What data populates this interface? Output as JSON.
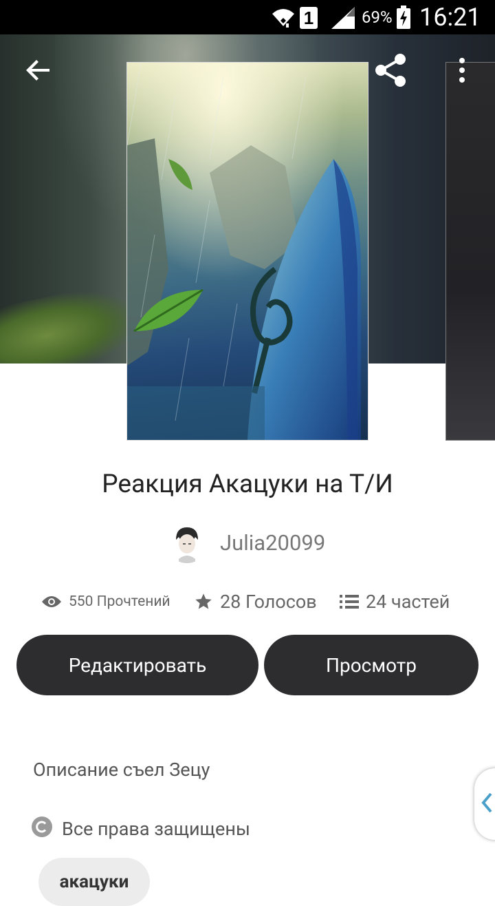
{
  "status_bar": {
    "sim_slot": "1",
    "battery_percent": "69%",
    "time": "16:21"
  },
  "story": {
    "title": "Реакция Акацуки на Т/И",
    "author": "Julia20099",
    "stats": {
      "reads": "550 Прочтений",
      "votes": "28 Голосов",
      "parts": "24 частей"
    },
    "description": "Описание съел Зецу",
    "rights": "Все права защищены",
    "tag": "акацуки"
  },
  "actions": {
    "edit_label": "Редактировать",
    "view_label": "Просмотр"
  },
  "colors": {
    "button_bg": "#2d2c2f",
    "button_text": "#ffffff",
    "title_text": "#222222",
    "muted_text": "#777777",
    "tag_bg": "#ececec",
    "status_bar_bg": "#000000"
  },
  "icons": {
    "back": "arrow-back-icon",
    "share": "share-icon",
    "more": "more-vert-icon",
    "reads": "eye-icon",
    "votes": "star-icon",
    "parts": "list-icon",
    "rights": "copyright-icon"
  }
}
